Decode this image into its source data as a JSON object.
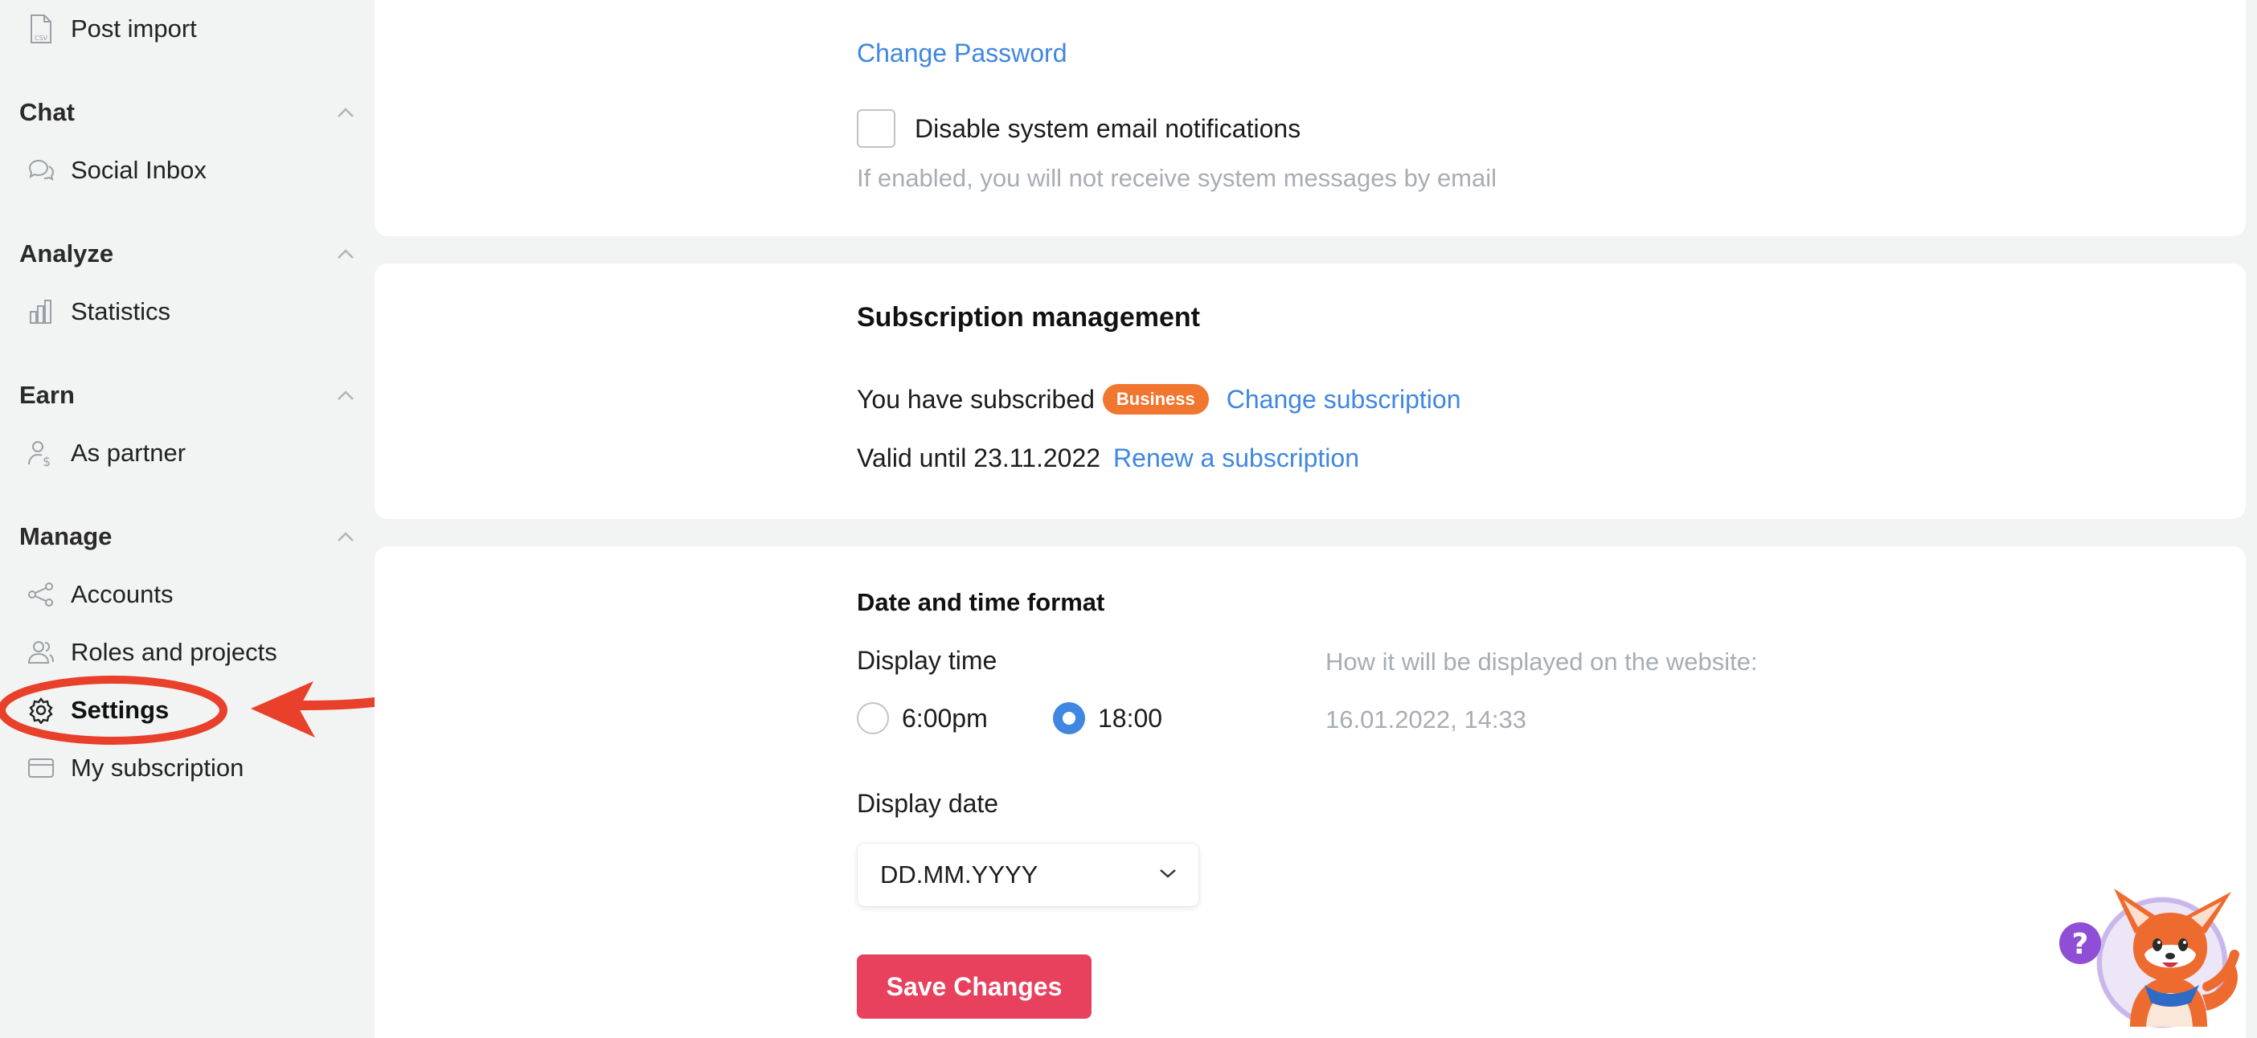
{
  "sidebar": {
    "post_import": {
      "label": "Post import",
      "icon": "csv-file-icon"
    },
    "sections": [
      {
        "title": "Chat",
        "items": [
          {
            "label": "Social Inbox",
            "icon": "chat-bubbles-icon"
          }
        ]
      },
      {
        "title": "Analyze",
        "items": [
          {
            "label": "Statistics",
            "icon": "bar-chart-icon"
          }
        ]
      },
      {
        "title": "Earn",
        "items": [
          {
            "label": "As partner",
            "icon": "user-dollar-icon"
          }
        ]
      },
      {
        "title": "Manage",
        "items": [
          {
            "label": "Accounts",
            "icon": "share-nodes-icon"
          },
          {
            "label": "Roles and projects",
            "icon": "users-icon"
          },
          {
            "label": "Settings",
            "icon": "gear-icon",
            "active": true
          },
          {
            "label": "My subscription",
            "icon": "credit-card-icon"
          }
        ]
      }
    ]
  },
  "account": {
    "change_password": "Change Password",
    "disable_notifications_label": "Disable system email notifications",
    "disable_notifications_checked": false,
    "disable_notifications_hint": "If enabled, you will not receive system messages by email"
  },
  "subscription": {
    "title": "Subscription management",
    "subscribed_text": "You have subscribed",
    "plan_badge": "Business",
    "change_link": "Change subscription",
    "valid_text": "Valid until 23.11.2022",
    "renew_link": "Renew a subscription"
  },
  "datetime": {
    "title": "Date and time format",
    "display_time_label": "Display time",
    "time_options": [
      {
        "label": "6:00pm",
        "selected": false
      },
      {
        "label": "18:00",
        "selected": true
      }
    ],
    "preview_label": "How it will be displayed on the website:",
    "preview_value": "16.01.2022, 14:33",
    "display_date_label": "Display date",
    "date_format_value": "DD.MM.YYYY",
    "save_button": "Save Changes"
  },
  "annotation": {
    "highlight_color": "#e8402a"
  },
  "colors": {
    "link": "#3f87e0",
    "badge": "#f1762f",
    "save": "#e8415e",
    "radio": "#3f87e0"
  }
}
